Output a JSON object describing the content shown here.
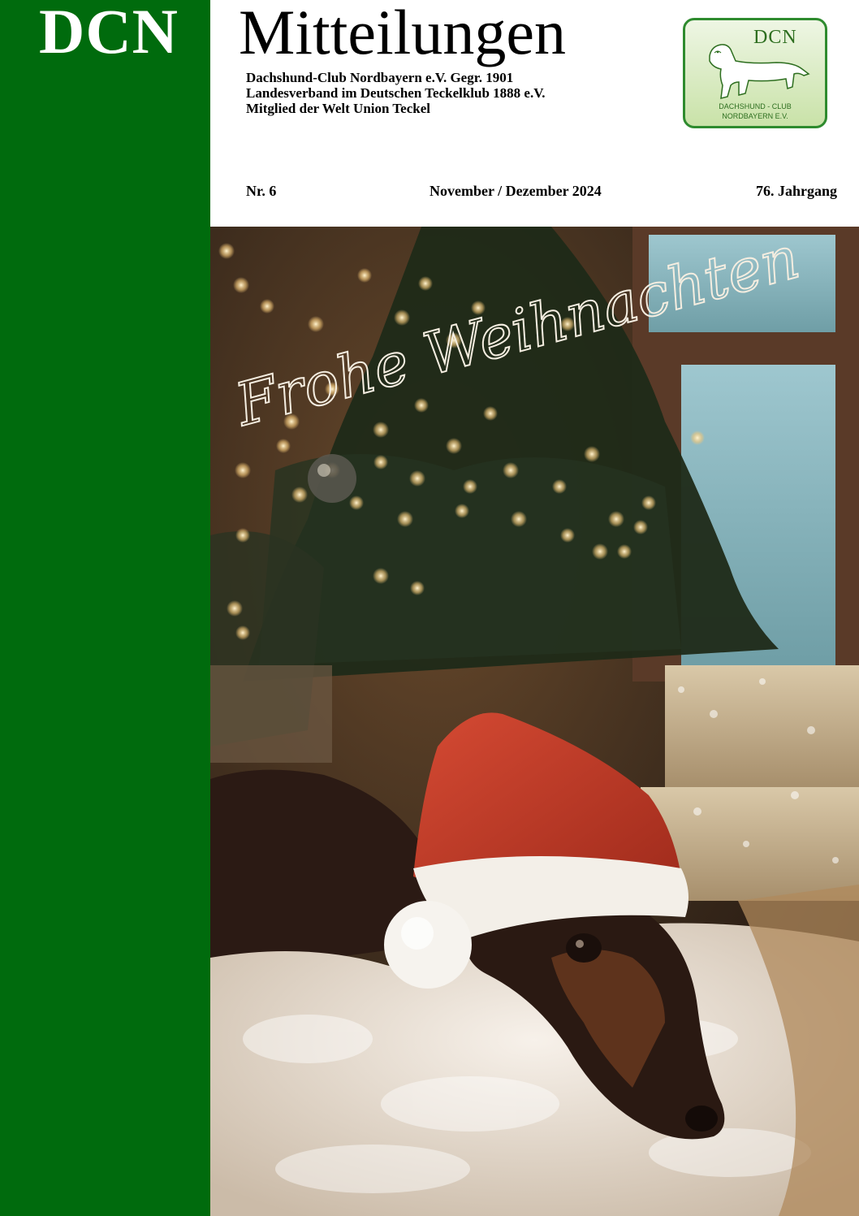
{
  "sidebar": {
    "title": "DCN"
  },
  "masthead": {
    "title": "Mitteilungen",
    "club_lines": [
      "Dachshund-Club Nordbayern e.V. Gegr. 1901",
      "Landesverband im Deutschen Teckelklub 1888 e.V.",
      "Mitglied der Welt Union Teckel"
    ]
  },
  "logo": {
    "initials": "DCN",
    "line1": "DACHSHUND - CLUB",
    "line2": "NORDBAYERN E.V."
  },
  "issue": {
    "number": "Nr. 6",
    "date": "November / Dezember 2024",
    "volume": "76. Jahrgang"
  },
  "cover": {
    "greeting": "Frohe Weihnachten"
  },
  "colors": {
    "sidebar_green": "#006b0d",
    "logo_green": "#2d6e1f",
    "hat_red": "#b8321f"
  }
}
